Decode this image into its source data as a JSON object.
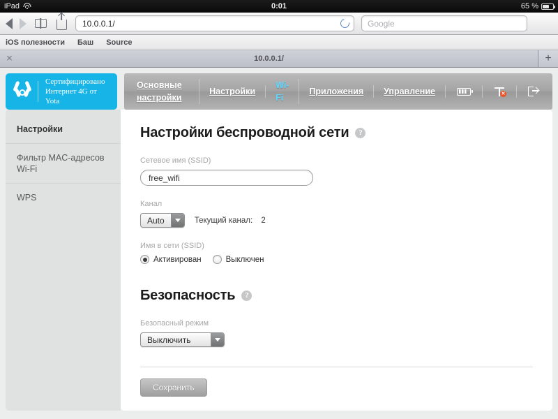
{
  "status_bar": {
    "device": "iPad",
    "wifi_icon": "wifi-icon",
    "time": "0:01",
    "battery_percent": "65 %",
    "battery_icon": "battery-icon"
  },
  "browser": {
    "back_icon": "back-arrow-icon",
    "forward_icon": "forward-arrow-icon",
    "bookmarks_icon": "book-icon",
    "share_icon": "share-icon",
    "url_value": "10.0.0.1/",
    "reload_icon": "reload-icon",
    "search_placeholder": "Google",
    "bookmarks": [
      {
        "label": "iOS полезности"
      },
      {
        "label": "Баш"
      },
      {
        "label": "Source"
      }
    ],
    "tabs": [
      {
        "title": "10.0.0.1/",
        "close_icon": "close-icon"
      }
    ],
    "new_tab_label": "+"
  },
  "router": {
    "brand": {
      "logo_icon": "yota-logo-icon",
      "line1": "Сертифицировано",
      "line2": "Интернет 4G от Yota"
    },
    "nav": [
      {
        "label": "Основные настройки",
        "active": false
      },
      {
        "label": "Настройки",
        "active": false
      },
      {
        "label": "Wi-Fi",
        "active": true
      },
      {
        "label": "Приложения",
        "active": false
      },
      {
        "label": "Управление",
        "active": false
      }
    ],
    "nav_icons": [
      {
        "name": "battery-status-icon"
      },
      {
        "name": "signal-error-icon"
      },
      {
        "name": "logout-icon"
      }
    ],
    "sidebar": [
      {
        "label": "Настройки",
        "active": true
      },
      {
        "label": "Фильтр MAC-адресов Wi-Fi",
        "active": false
      },
      {
        "label": "WPS",
        "active": false
      }
    ],
    "wireless": {
      "title": "Настройки беспроводной сети",
      "help_glyph": "?",
      "ssid_label": "Сетевое имя (SSID)",
      "ssid_value": "free_wifi",
      "channel_label": "Канал",
      "channel_value": "Auto",
      "current_channel_label": "Текущий канал:",
      "current_channel_value": "2",
      "broadcast_label": "Имя в сети (SSID)",
      "radio_on": "Активирован",
      "radio_off": "Выключен"
    },
    "security": {
      "title": "Безопасность",
      "help_glyph": "?",
      "mode_label": "Безопасный режим",
      "mode_value": "Выключить"
    },
    "save_label": "Сохранить"
  },
  "colors": {
    "brand_cyan": "#17b4e8",
    "active_nav": "#5fd8ff",
    "error_badge": "#f04e23",
    "page_bg": "#eceded"
  }
}
